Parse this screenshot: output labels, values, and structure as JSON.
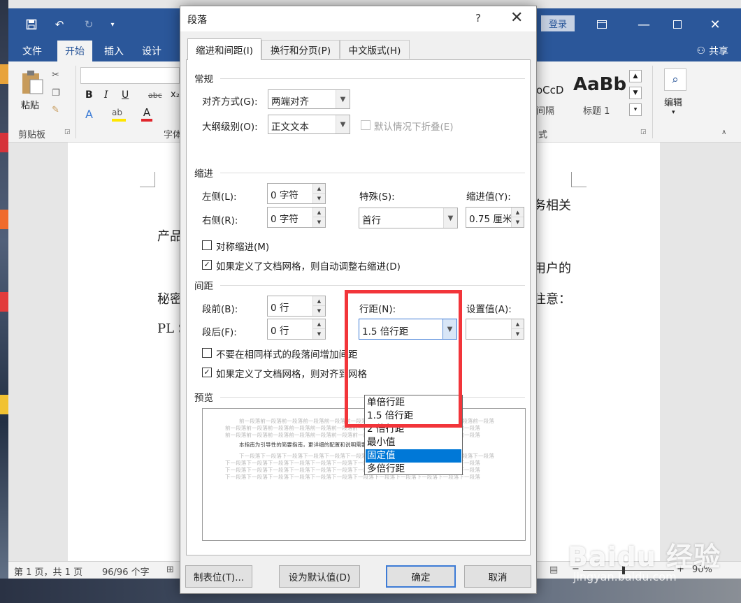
{
  "word": {
    "login_label": "登录",
    "ribbon_tabs": [
      "文件",
      "开始",
      "插入",
      "设计"
    ],
    "active_tab": "开始",
    "share_label": "共享",
    "clipboard_group": "剪贴板",
    "paste_label": "粘贴",
    "font_group_partial": "字体",
    "styles_partial_group": "式",
    "style_samples": [
      {
        "sample": "oCcD",
        "name": "间隔"
      },
      {
        "sample": "AaBb",
        "name": "标题 1"
      }
    ],
    "edit_label": "编辑",
    "status": {
      "page": "第 1 页，共 1 页",
      "words": "96/96 个字",
      "zoom": "90%"
    },
    "doc_fragments": [
      "产品",
      "秘密",
      "PL S",
      "务相关",
      "用户的",
      "注意："
    ]
  },
  "dialog": {
    "title": "段落",
    "help": "?",
    "close": "✕",
    "tabs": [
      "缩进和间距(I)",
      "换行和分页(P)",
      "中文版式(H)"
    ],
    "general": {
      "heading": "常规",
      "alignment_label": "对齐方式(G):",
      "alignment_value": "两端对齐",
      "outline_label": "大纲级别(O):",
      "outline_value": "正文文本",
      "collapse_label": "默认情况下折叠(E)"
    },
    "indent": {
      "heading": "缩进",
      "left_label": "左侧(L):",
      "left_value": "0 字符",
      "right_label": "右侧(R):",
      "right_value": "0 字符",
      "special_label": "特殊(S):",
      "special_value": "首行",
      "by_label": "缩进值(Y):",
      "by_value": "0.75 厘米",
      "mirror_label": "对称缩进(M)",
      "auto_adjust_label": "如果定义了文档网格，则自动调整右缩进(D)"
    },
    "spacing": {
      "heading": "间距",
      "before_label": "段前(B):",
      "before_value": "0 行",
      "after_label": "段后(F):",
      "after_value": "0 行",
      "line_label": "行距(N):",
      "line_value": "1.5 倍行距",
      "at_label": "设置值(A):",
      "no_space_label": "不要在相同样式的段落间增加间距",
      "snap_grid_label": "如果定义了文档网格，则对齐到网格",
      "line_options": [
        "单倍行距",
        "1.5 倍行距",
        "2 倍行距",
        "最小值",
        "固定值",
        "多倍行距"
      ],
      "highlighted_option": "固定值"
    },
    "preview": {
      "heading": "预览",
      "prev_para": "前一段落前一段落前一段落前一段落前一段落前一段落前一段落前一段落前一段落前一段落前一段落前一段落",
      "sample": "本指南为引导性的简要指南，更详细的配置和说明需要参考相关产品的产品文档。",
      "next_para": "下一段落下一段落下一段落下一段落下一段落下一段落下一段落下一段落下一段落下一段落下一段落下一段落"
    },
    "buttons": {
      "tabs": "制表位(T)...",
      "set_default": "设为默认值(D)",
      "ok": "确定",
      "cancel": "取消"
    }
  },
  "watermark": {
    "brand": "Baidu 经验",
    "url": "jingyan.baidu.com"
  },
  "colors": {
    "word_blue": "#2b579a",
    "highlight_red": "#f2353a",
    "selection_blue": "#0078d7"
  }
}
